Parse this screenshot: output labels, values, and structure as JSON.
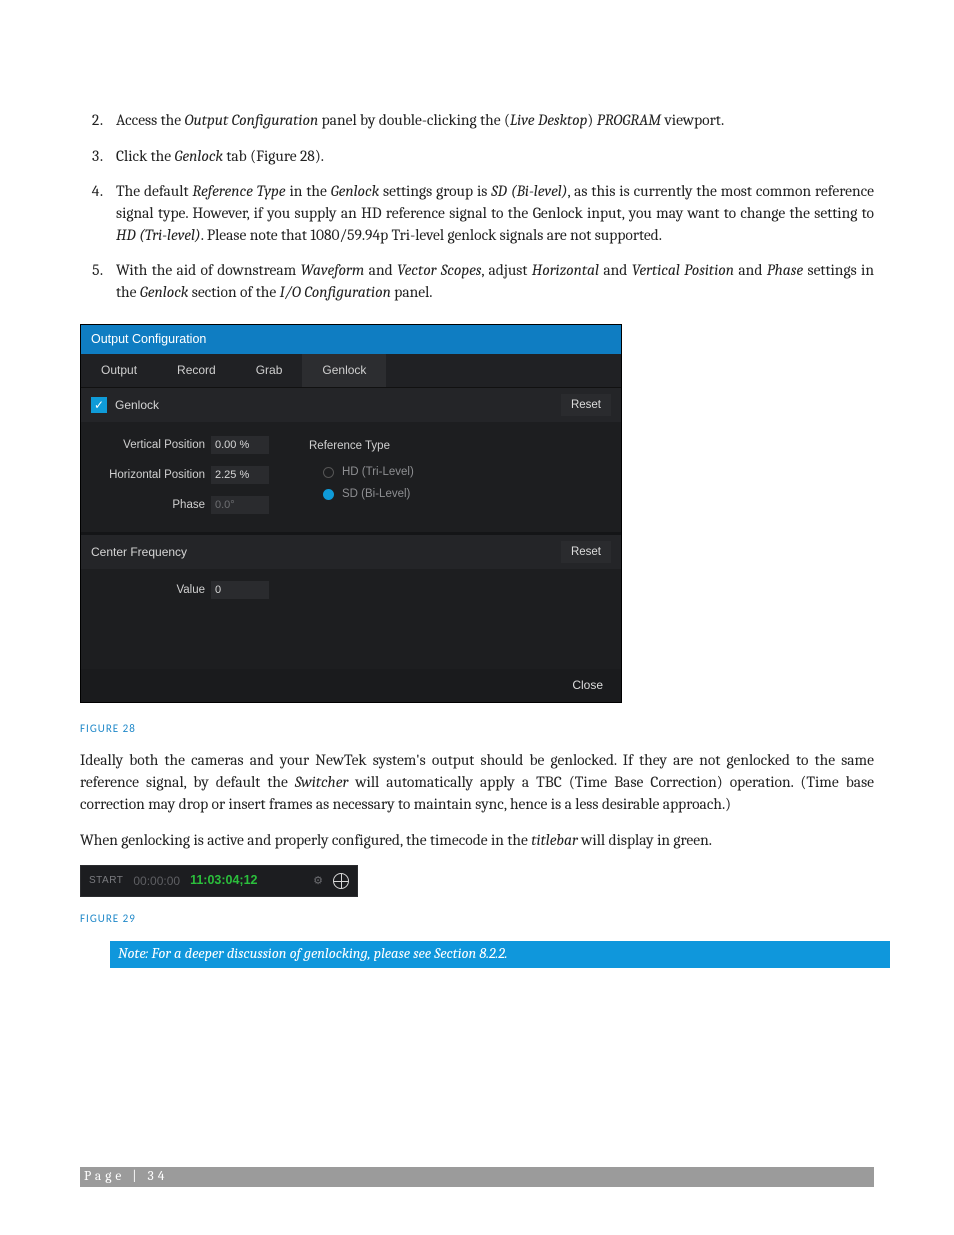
{
  "instructions": {
    "item2_pre": "Access the ",
    "item2_em1": "Output Configuration",
    "item2_mid": " panel by double-clicking the (",
    "item2_em2": "Live Desktop",
    "item2_mid2": ") ",
    "item2_em3": "PROGRAM",
    "item2_end": " viewport.",
    "item3_pre": "Click the ",
    "item3_em1": "Genlock",
    "item3_end": " tab (Figure 28).",
    "item4_a": "The default ",
    "item4_em1": "Reference Type",
    "item4_b": " in the ",
    "item4_em2": "Genlock",
    "item4_c": " settings group is ",
    "item4_em3": "SD (Bi-level)",
    "item4_d": ", as this is currently the most common reference signal type.  However, if you supply an HD reference signal to the Genlock input, you may want to change the setting to ",
    "item4_em4": "HD (Tri-level)",
    "item4_e": ".  Please note that 1080/59.94p Tri-level genlock signals are not supported.",
    "item5_a": "With the aid of downstream ",
    "item5_em1": "Waveform",
    "item5_b": " and ",
    "item5_em2": "Vector Scopes",
    "item5_c": ", adjust ",
    "item5_em3": "Horizontal",
    "item5_d": " and ",
    "item5_em4": "Vertical Position",
    "item5_e": " and ",
    "item5_em5": "Phase",
    "item5_f": " settings in the ",
    "item5_em6": "Genlock",
    "item5_g": " section of the ",
    "item5_em7": "I/O Configuration",
    "item5_h": " panel."
  },
  "figure28": {
    "title": "Output Configuration",
    "tabs": {
      "output": "Output",
      "record": "Record",
      "grab": "Grab",
      "genlock": "Genlock"
    },
    "genlock": {
      "section_label": "Genlock",
      "reset": "Reset",
      "vertical_position_label": "Vertical Position",
      "vertical_position_value": "0.00 %",
      "horizontal_position_label": "Horizontal Position",
      "horizontal_position_value": "2.25 %",
      "phase_label": "Phase",
      "phase_value": "0.0°",
      "reference_type_label": "Reference Type",
      "ref_hd": "HD (Tri-Level)",
      "ref_sd": "SD (Bi-Level)"
    },
    "center_freq": {
      "section_label": "Center Frequency",
      "reset": "Reset",
      "value_label": "Value",
      "value": "0"
    },
    "close": "Close",
    "caption": "FIGURE 28"
  },
  "para1_a": "Ideally both the cameras and your NewTek system's output should be genlocked.  If they are not genlocked to the same reference signal, by default the ",
  "para1_em": "Switcher",
  "para1_b": " will automatically apply a TBC (Time Base Correction) operation.  (Time base correction may drop or insert frames as necessary to maintain sync, hence is a less desirable approach.)",
  "para2_a": "When genlocking is active and properly configured, the timecode in the ",
  "para2_em": "titlebar",
  "para2_b": " will display in green.",
  "figure29": {
    "start_label": "START",
    "start_time": "00:00:00",
    "current_time": "11:03:04;12",
    "caption": "FIGURE 29"
  },
  "note": "Note: For a deeper discussion of genlocking, please see Section 8.2.2.",
  "footer": "Page | 34"
}
